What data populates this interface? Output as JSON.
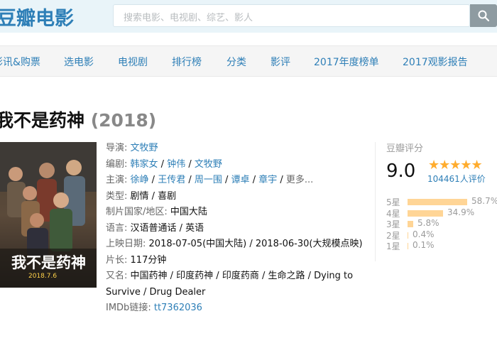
{
  "header": {
    "logo": "豆瓣电影",
    "search_placeholder": "搜索电影、电视剧、综艺、影人",
    "search_icon": "search-icon"
  },
  "nav": {
    "items": [
      {
        "label": "影讯&购票"
      },
      {
        "label": "选电影"
      },
      {
        "label": "电视剧"
      },
      {
        "label": "排行榜"
      },
      {
        "label": "分类"
      },
      {
        "label": "影评"
      },
      {
        "label": "2017年度榜单"
      },
      {
        "label": "2017观影报告"
      }
    ]
  },
  "movie": {
    "title": "我不是药神",
    "year": "(2018)",
    "poster_title": "我不是药神",
    "poster_date": "2018.7.6",
    "director_label": "导演:",
    "director": "文牧野",
    "writers_label": "编剧:",
    "writers": [
      "韩家女",
      "钟伟",
      "文牧野"
    ],
    "cast_label": "主演:",
    "cast": [
      "徐峥",
      "王传君",
      "周一围",
      "谭卓",
      "章宇"
    ],
    "cast_more": "更多...",
    "genre_label": "类型:",
    "genres": "剧情 / 喜剧",
    "country_label": "制片国家/地区:",
    "country": "中国大陆",
    "language_label": "语言:",
    "language": "汉语普通话 / 英语",
    "release_label": "上映日期:",
    "release": "2018-07-05(中国大陆) / 2018-06-30(大规模点映)",
    "runtime_label": "片长:",
    "runtime": "117分钟",
    "aka_label": "又名:",
    "aka": "中国药神 / 印度药神 / 印度药商 / 生命之路 / Dying to Survive / Drug Dealer",
    "imdb_label": "IMDb链接:",
    "imdb": "tt7362036"
  },
  "rating": {
    "title": "豆瓣评分",
    "score": "9.0",
    "stars": "★★★★★",
    "votes": "104461人评价",
    "distribution": [
      {
        "label": "5星",
        "percent": 58.7,
        "text": "58.7%"
      },
      {
        "label": "4星",
        "percent": 34.9,
        "text": "34.9%"
      },
      {
        "label": "3星",
        "percent": 5.8,
        "text": "5.8%"
      },
      {
        "label": "2星",
        "percent": 0.4,
        "text": "0.4%"
      },
      {
        "label": "1星",
        "percent": 0.1,
        "text": "0.1%"
      }
    ]
  },
  "colors": {
    "link": "#2e7fb7",
    "star": "#ffac2d",
    "bar": "#ffd596"
  }
}
